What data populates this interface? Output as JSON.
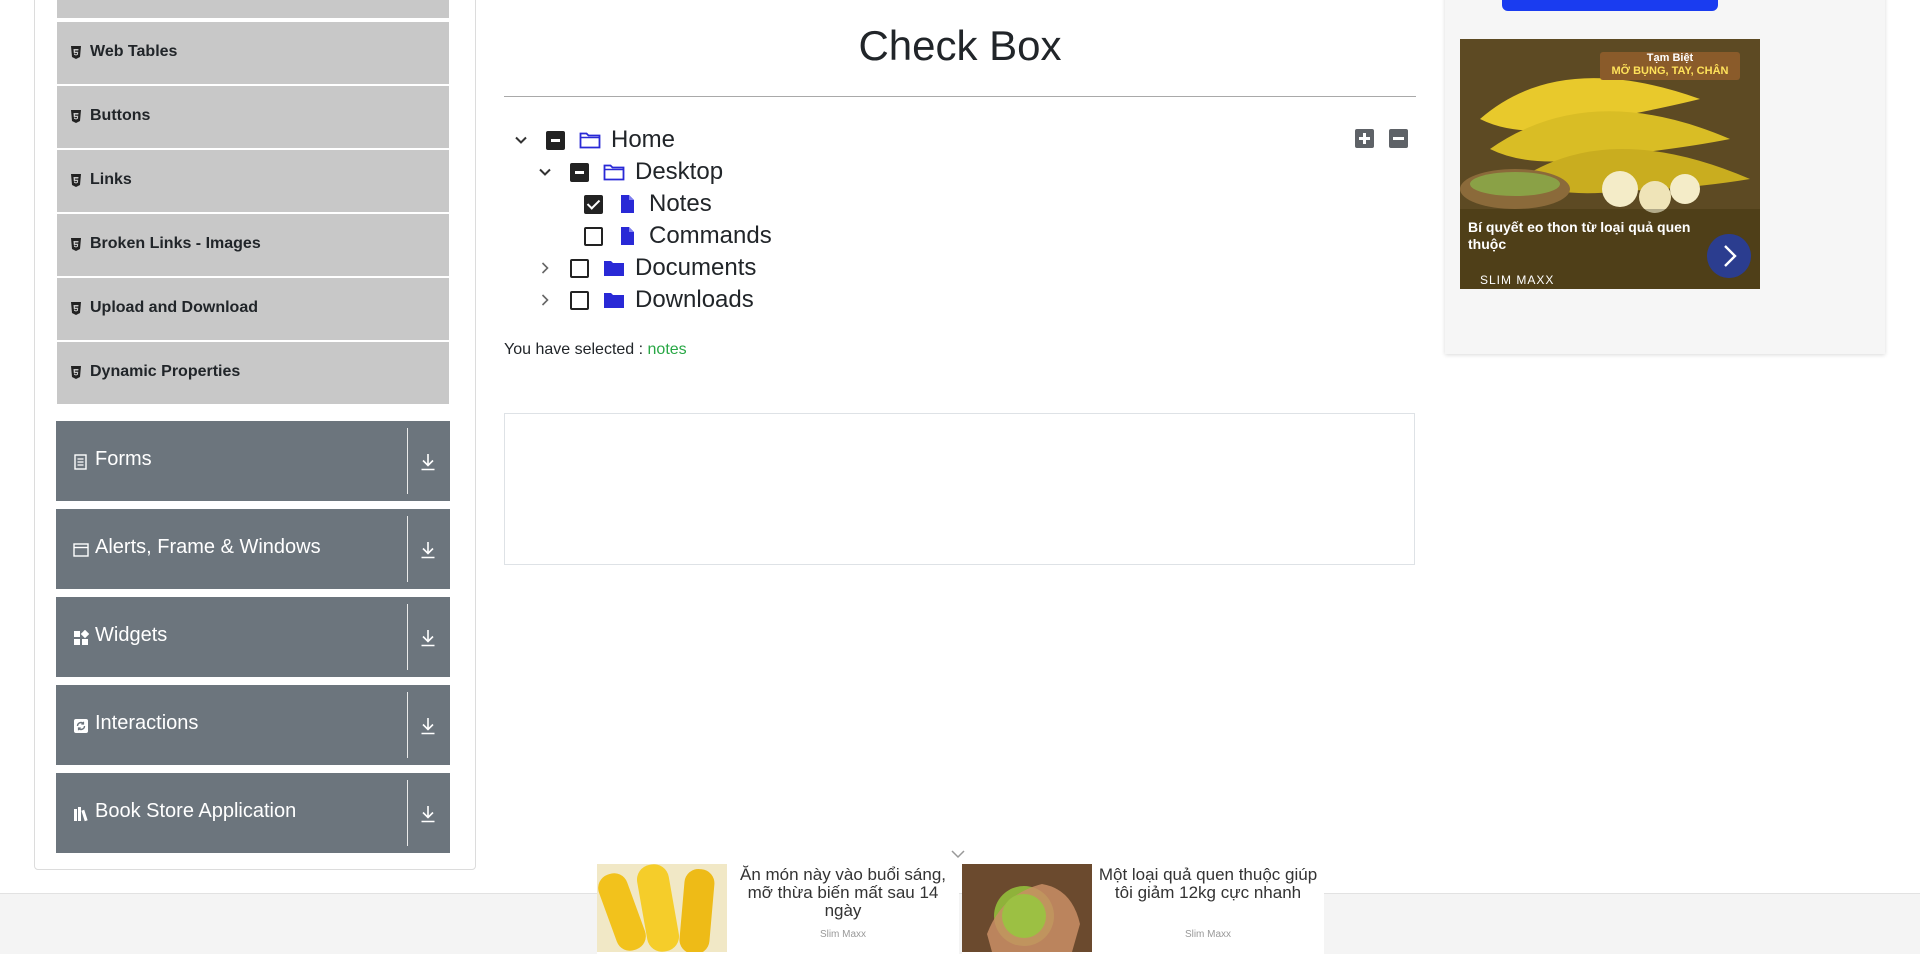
{
  "sidebar": {
    "element_items": [
      {
        "label": "Web Tables",
        "icon": "html5-icon"
      },
      {
        "label": "Buttons",
        "icon": "html5-icon"
      },
      {
        "label": "Links",
        "icon": "html5-icon"
      },
      {
        "label": "Broken Links - Images",
        "icon": "html5-icon"
      },
      {
        "label": "Upload and Download",
        "icon": "html5-icon"
      },
      {
        "label": "Dynamic Properties",
        "icon": "html5-icon"
      }
    ],
    "groups": [
      {
        "label": "Forms",
        "icon": "form-icon"
      },
      {
        "label": "Alerts, Frame & Windows",
        "icon": "window-icon"
      },
      {
        "label": "Widgets",
        "icon": "widgets-icon"
      },
      {
        "label": "Interactions",
        "icon": "interactions-icon"
      },
      {
        "label": "Book Store Application",
        "icon": "book-store-icon"
      }
    ]
  },
  "main": {
    "title": "Check Box",
    "tree": [
      {
        "label": "Home",
        "state": "partial",
        "expanded": true,
        "type": "folder"
      },
      {
        "label": "Desktop",
        "state": "partial",
        "expanded": true,
        "type": "folder"
      },
      {
        "label": "Notes",
        "state": "checked",
        "type": "file"
      },
      {
        "label": "Commands",
        "state": "unchecked",
        "type": "file"
      },
      {
        "label": "Documents",
        "state": "unchecked",
        "expanded": false,
        "type": "folder"
      },
      {
        "label": "Downloads",
        "state": "unchecked",
        "expanded": false,
        "type": "folder"
      }
    ],
    "result_prefix": "You have selected :",
    "result_values": "notes"
  },
  "ads": {
    "side": {
      "badge_line1": "Tạm Biệt",
      "badge_line2": "MỠ BỤNG, TAY, CHÂN",
      "caption": "Bí quyết eo thon từ loại quả quen thuộc",
      "brand": "SLIM MAXX"
    },
    "bottom": [
      {
        "text": "Ăn món này vào buổi sáng, mỡ thừa biến mất sau 14 ngày",
        "brand": "Slim Maxx"
      },
      {
        "text": "Một loại quả quen thuộc giúp tôi giảm 12kg cực nhanh",
        "brand": "Slim Maxx"
      }
    ]
  },
  "colors": {
    "accent": "#1a3cf0",
    "sidebar_group": "#6c757d",
    "sidebar_item": "#c8c8c8",
    "selected_text": "#28a745",
    "tree_icon": "#2929d6"
  }
}
